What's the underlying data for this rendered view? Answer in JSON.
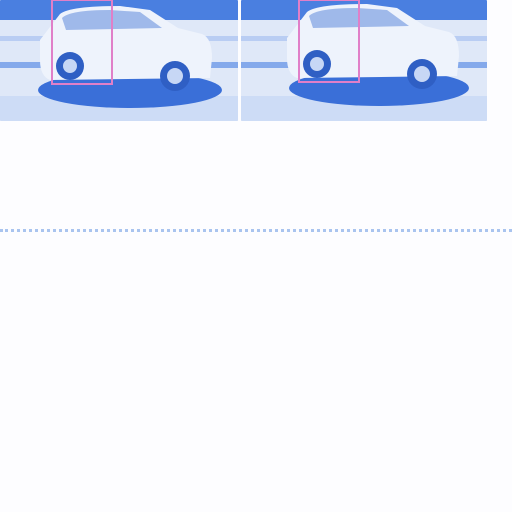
{
  "colors": {
    "sky": "#4a7fe0",
    "street": "#dfe8f8",
    "sidewalk": "#c8d8f4",
    "car_body": "#eef3fc",
    "car_shadow": "#3a6fd8",
    "window": "#9fb9ea",
    "highlight_box": "#e07fc8",
    "divider": "#a9c4ef",
    "background": "#fdfdff"
  },
  "thumbnails": [
    {
      "subject": "white-suv",
      "highlight": "rear-door-region"
    },
    {
      "subject": "white-suv",
      "highlight": "rear-door-region"
    }
  ]
}
